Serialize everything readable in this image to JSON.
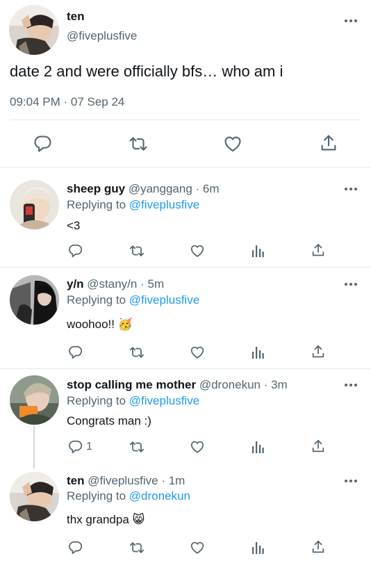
{
  "main_tweet": {
    "display_name": "ten",
    "handle": "@fiveplusfive",
    "text": "date 2 and were officially bfs… who am i",
    "timestamp": "09:04 PM · 07 Sep 24"
  },
  "replies": [
    {
      "display_name": "sheep guy",
      "handle": "@yanggang",
      "time": "· 6m",
      "replying_label": "Replying to",
      "replying_to": "@fiveplusfive",
      "text": "<3",
      "reply_count": ""
    },
    {
      "display_name": "y/n",
      "handle": "@stany/n",
      "time": "· 5m",
      "replying_label": "Replying to",
      "replying_to": "@fiveplusfive",
      "text": "woohoo!! 🥳",
      "reply_count": ""
    },
    {
      "display_name": "stop calling me mother",
      "handle": "@dronekun",
      "time": "· 3m",
      "replying_label": "Replying to",
      "replying_to": "@fiveplusfive",
      "text": "Congrats man :)",
      "reply_count": "1"
    },
    {
      "display_name": "ten",
      "handle": "@fiveplusfive",
      "time": "· 1m",
      "replying_label": "Replying to",
      "replying_to": "@dronekun",
      "text": "thx grandpa 😸",
      "reply_count": ""
    }
  ],
  "icons": {
    "reply": "reply-icon",
    "retweet": "retweet-icon",
    "like": "like-icon",
    "views": "views-icon",
    "share": "share-icon",
    "more": "more-icon"
  },
  "colors": {
    "link": "#1d9bf0",
    "secondary_text": "#536471",
    "divider": "#e6e9ec"
  }
}
